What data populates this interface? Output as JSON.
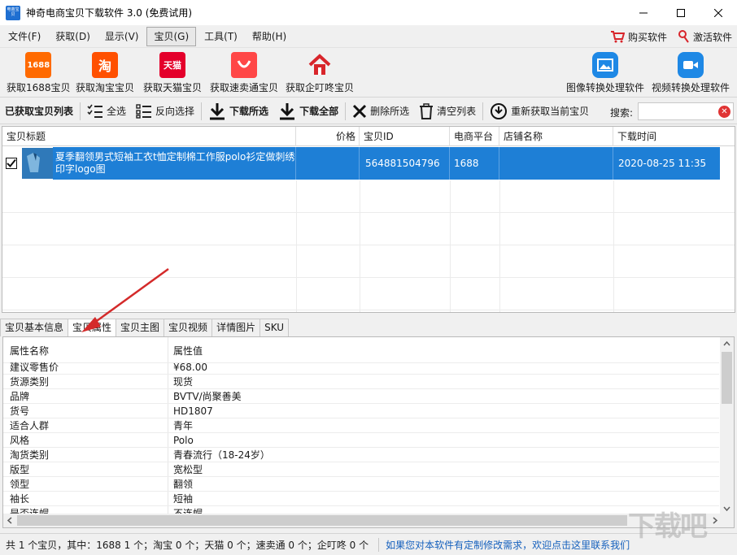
{
  "window": {
    "title": "神奇电商宝贝下载软件 3.0 (免费试用)",
    "icon_text": "电商宝贝",
    "controls": [
      "—",
      "☐",
      "✕"
    ]
  },
  "menu": {
    "items": [
      "文件(F)",
      "获取(D)",
      "显示(V)",
      "宝贝(G)",
      "工具(T)",
      "帮助(H)"
    ],
    "active_index": 3,
    "right": {
      "buy": "购买软件",
      "activate": "激活软件"
    }
  },
  "toolbar_big": {
    "items": [
      {
        "label": "获取1688宝贝",
        "icon_text": "1688",
        "icon": "1688-icon"
      },
      {
        "label": "获取淘宝宝贝",
        "icon_text": "淘",
        "icon": "taobao-icon"
      },
      {
        "label": "获取天猫宝贝",
        "icon_text": "天猫",
        "icon": "tmall-icon"
      },
      {
        "label": "获取速卖通宝贝",
        "icon_text": "",
        "icon": "aliexpress-icon"
      },
      {
        "label": "获取企叮咚宝贝",
        "icon_text": "",
        "icon": "qidingdong-icon"
      }
    ],
    "right_items": [
      {
        "label": "图像转换处理软件",
        "icon": "image-convert-icon"
      },
      {
        "label": "视频转换处理软件",
        "icon": "video-convert-icon"
      }
    ]
  },
  "toolbar_small": {
    "list_label": "已获取宝贝列表",
    "select_all": "全选",
    "invert": "反向选择",
    "download_selected": "下载所选",
    "download_all": "下载全部",
    "delete_selected": "删除所选",
    "clear_list": "清空列表",
    "refetch": "重新获取当前宝贝",
    "search_label": "搜索:",
    "search_value": ""
  },
  "main_table": {
    "columns": [
      "宝贝标题",
      "价格",
      "宝贝ID",
      "电商平台",
      "店铺名称",
      "下载时间"
    ],
    "rows": [
      {
        "checked": true,
        "title": "夏季翻领男式短袖工衣t恤定制棉工作服polo衫定做刺绣印字logo图",
        "price": "",
        "id": "564881504796",
        "platform": "1688",
        "shop": "",
        "time": "2020-08-25 11:35"
      }
    ]
  },
  "tabs": {
    "items": [
      "宝贝基本信息",
      "宝贝属性",
      "宝贝主图",
      "宝贝视频",
      "详情图片",
      "SKU"
    ],
    "active_index": 1
  },
  "properties": {
    "header": {
      "name": "属性名称",
      "value": "属性值"
    },
    "rows": [
      {
        "name": "建议零售价",
        "value": "¥68.00"
      },
      {
        "name": "货源类别",
        "value": "现货"
      },
      {
        "name": "品牌",
        "value": "BVTV/尚聚善美"
      },
      {
        "name": "货号",
        "value": "HD1807"
      },
      {
        "name": "适合人群",
        "value": "青年"
      },
      {
        "name": "风格",
        "value": "Polo"
      },
      {
        "name": "淘货类别",
        "value": "青春流行（18-24岁）"
      },
      {
        "name": "版型",
        "value": "宽松型"
      },
      {
        "name": "领型",
        "value": "翻领"
      },
      {
        "name": "袖长",
        "value": "短袖"
      },
      {
        "name": "是否连帽",
        "value": "不连帽"
      }
    ]
  },
  "status": {
    "summary": "共 1 个宝贝，其中：1688 1 个；淘宝 0 个；天猫 0 个；速卖通 0 个；企叮咚 0 个",
    "link": "如果您对本软件有定制修改需求，欢迎点击这里联系我们"
  },
  "watermark": "下载吧",
  "colors": {
    "selection": "#1e7fd6",
    "link": "#1560bd",
    "arrow": "#d42a2a",
    "alibaba_orange": "#ff6a00",
    "tmall_red": "#e4002b"
  }
}
